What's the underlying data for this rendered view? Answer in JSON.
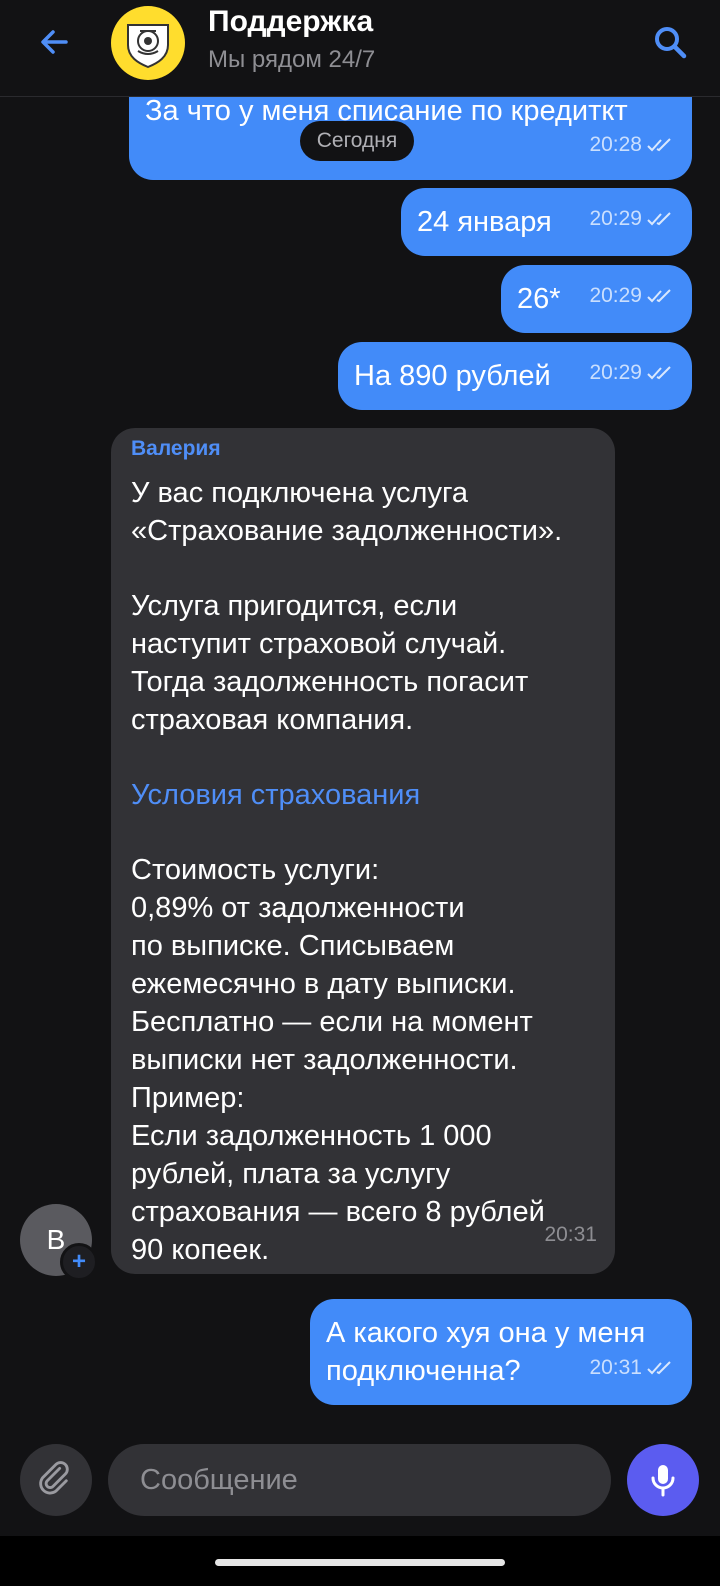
{
  "header": {
    "title": "Поддержка",
    "subtitle": "Мы рядом 24/7"
  },
  "date_separator": "Сегодня",
  "messages": [
    {
      "text": "За что у меня списание по кредиткт",
      "time": "20:28"
    },
    {
      "text": "24 января",
      "time": "20:29"
    },
    {
      "text": "26*",
      "time": "20:29"
    },
    {
      "text": "На 890 рублей",
      "time": "20:29"
    },
    {
      "sender": "Валерия",
      "p1": "У вас подключена услуга\n«Страхование задолженности».",
      "p2": "Услуга пригодится, если\nнаступит страховой случай.\nТогда задолженность погасит\nстраховая компания.",
      "link": "Условия страхования",
      "p3": "Стоимость услуги:\n0,89% от задолженности\nпо выписке. Списываем\nежемесячно в дату выписки.\nБесплатно — если на момент\nвыписки нет задолженности.\nПример:\nЕсли задолженность 1 000\nрублей, плата за услугу\nстрахования — всего 8 рублей\n90 копеек.",
      "time": "20:31"
    },
    {
      "text": "А какого хуя она у меня\nподключенна?",
      "time": "20:31"
    }
  ],
  "user_avatar": {
    "initial": "В",
    "badge": "+"
  },
  "composer": {
    "placeholder": "Сообщение"
  },
  "icons": [
    "back-arrow-icon",
    "search-icon",
    "paperclip-icon",
    "microphone-icon",
    "double-check-icon"
  ],
  "colors": {
    "accent": "#428bf9",
    "background": "#121214",
    "incoming": "#323236",
    "mic": "#5b5cf0",
    "logo": "#ffdd2d"
  }
}
